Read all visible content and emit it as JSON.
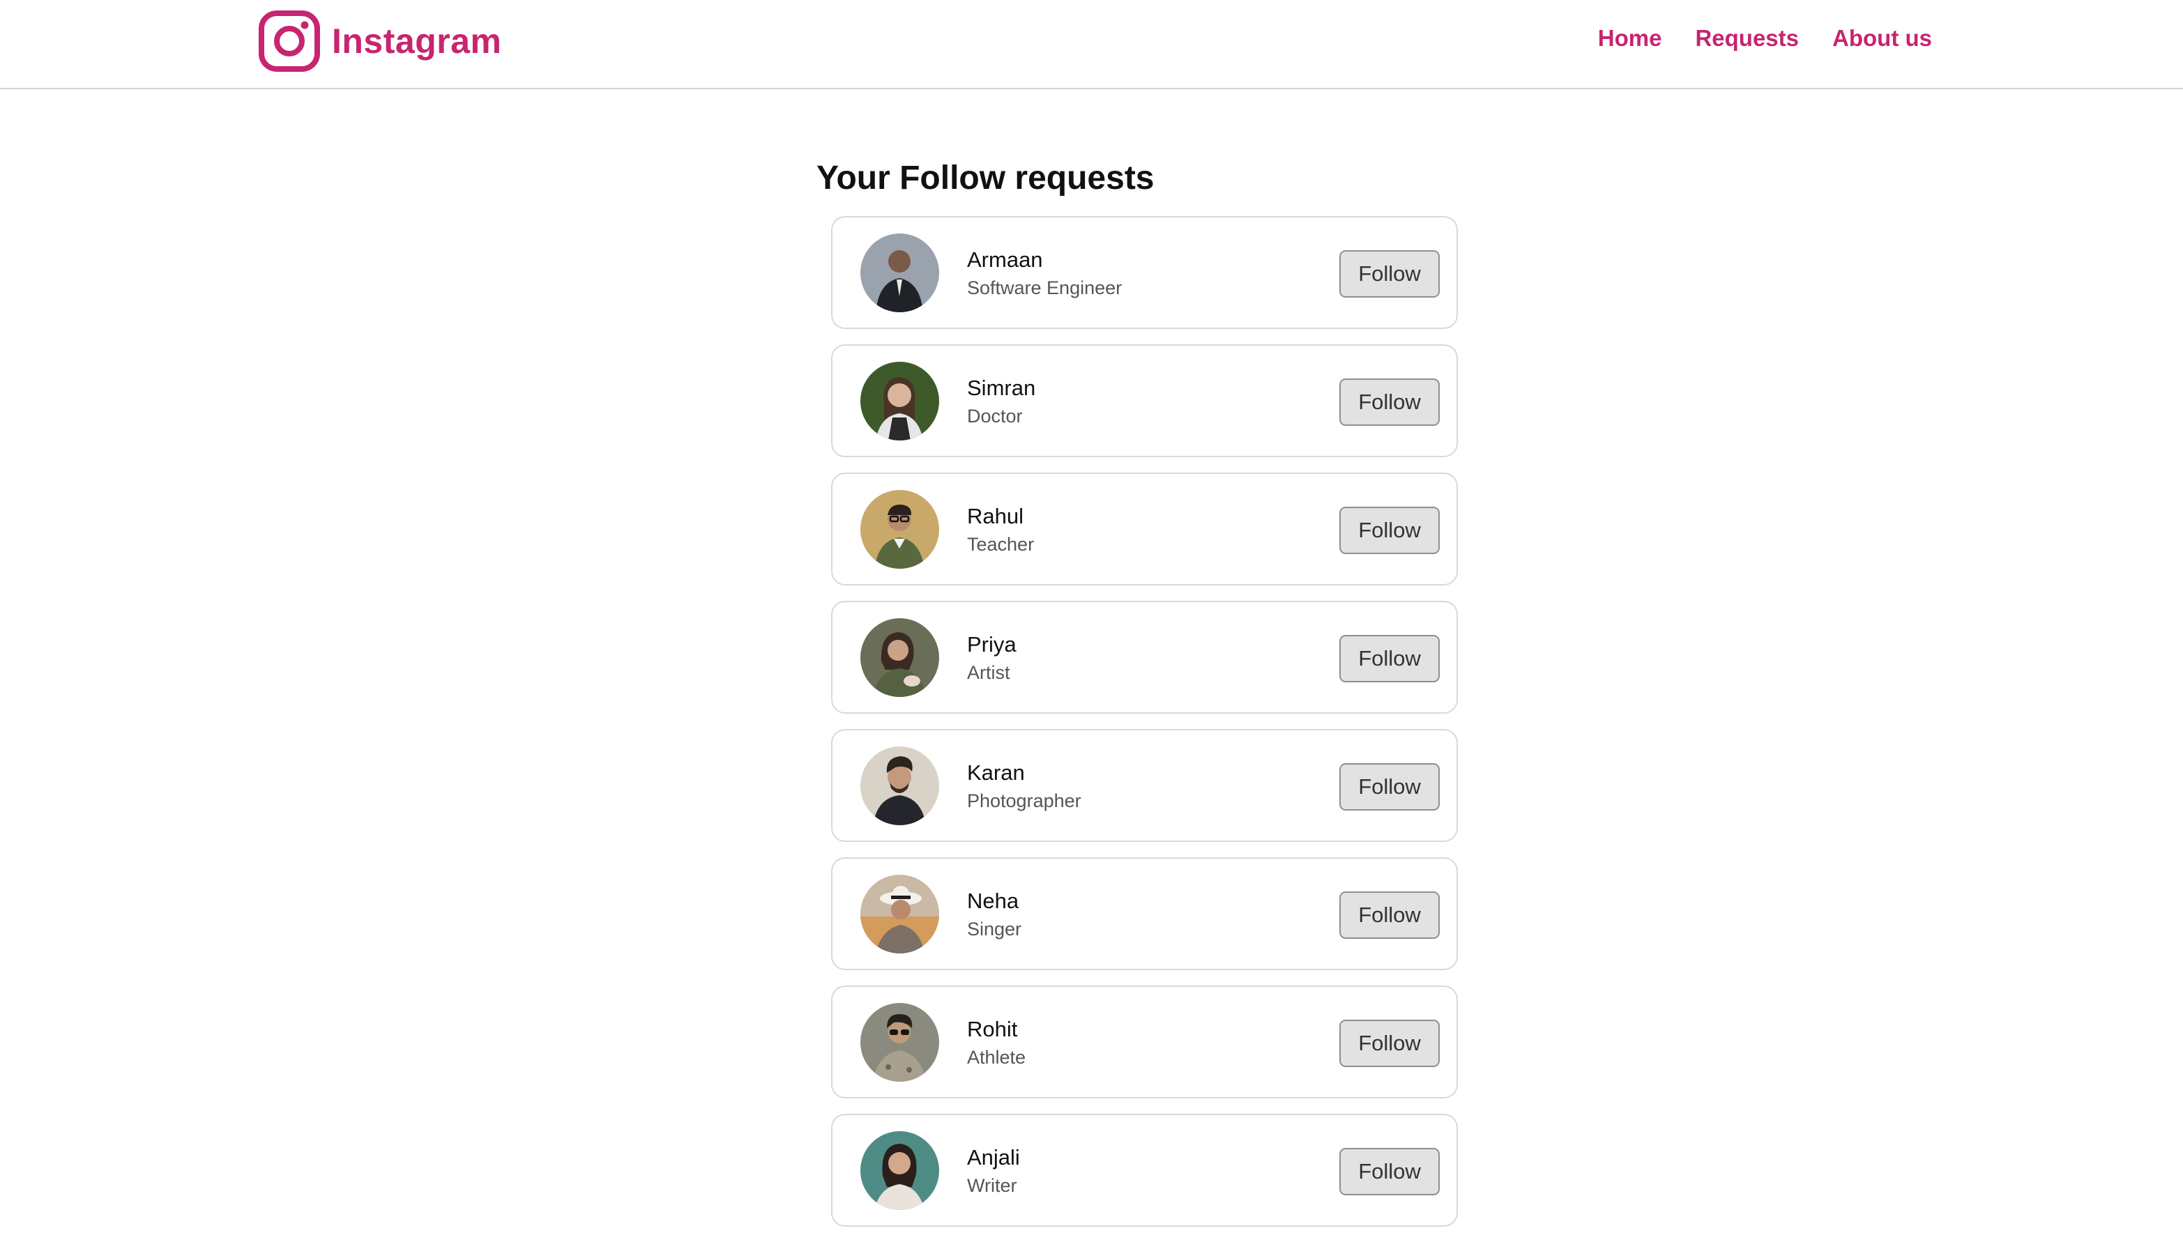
{
  "navbar": {
    "brand_name": "Instagram",
    "brand_color": "#c8246f",
    "brand_icon": "instagram-logo-icon",
    "links": [
      {
        "label": "Home"
      },
      {
        "label": "Requests"
      },
      {
        "label": "About us"
      }
    ]
  },
  "page": {
    "title": "Your Follow requests"
  },
  "requests": [
    {
      "name": "Armaan",
      "role": "Software Engineer",
      "button": "Follow",
      "avatar_bg": "#9aa3ad"
    },
    {
      "name": "Simran",
      "role": "Doctor",
      "button": "Follow",
      "avatar_bg": "#3f5a2a"
    },
    {
      "name": "Rahul",
      "role": "Teacher",
      "button": "Follow",
      "avatar_bg": "#c9a96a"
    },
    {
      "name": "Priya",
      "role": "Artist",
      "button": "Follow",
      "avatar_bg": "#6a6e58"
    },
    {
      "name": "Karan",
      "role": "Photographer",
      "button": "Follow",
      "avatar_bg": "#d8d2c7"
    },
    {
      "name": "Neha",
      "role": "Singer",
      "button": "Follow",
      "avatar_bg": "#c9b9a5"
    },
    {
      "name": "Rohit",
      "role": "Athlete",
      "button": "Follow",
      "avatar_bg": "#8b8a7e"
    },
    {
      "name": "Anjali",
      "role": "Writer",
      "button": "Follow",
      "avatar_bg": "#4f8c86"
    }
  ]
}
